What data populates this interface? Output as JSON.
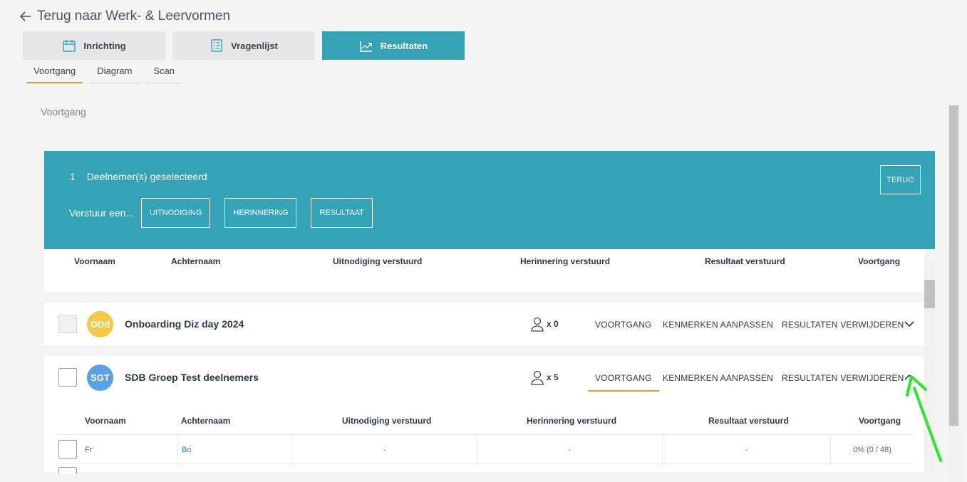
{
  "nav": {
    "back_label": "Terug naar Werk- & Leervormen"
  },
  "main_tabs": [
    {
      "label": "Inrichting",
      "icon": "calendar-icon"
    },
    {
      "label": "Vragenlijst",
      "icon": "checklist-icon"
    },
    {
      "label": "Resultaten",
      "icon": "trend-chart-icon",
      "active": true
    }
  ],
  "sub_tabs": [
    {
      "label": "Voortgang",
      "active": true
    },
    {
      "label": "Diagram"
    },
    {
      "label": "Scan"
    }
  ],
  "section_title": "Voortgang",
  "selection_bar": {
    "count": "1",
    "count_label": "Deelnemer(s) geselecteerd",
    "send_label": "Verstuur een...",
    "buttons": [
      "UITNODIGING",
      "HERINNERING",
      "RESULTAAT"
    ],
    "back_button": "TERUG"
  },
  "columns": {
    "first_name": "Voornaam",
    "last_name": "Achternaam",
    "invite_sent": "Uitnodiging verstuurd",
    "reminder_sent": "Herinnering verstuurd",
    "result_sent": "Resultaat verstuurd",
    "progress": "Voortgang"
  },
  "groups": [
    {
      "initials": "ODd",
      "name": "Onboarding Diz day 2024",
      "members": "x 0",
      "expanded": false
    },
    {
      "initials": "SGT",
      "name": "SDB Groep Test deelnemers",
      "members": "x 5",
      "expanded": true
    }
  ],
  "group_actions": {
    "progress": "VOORTGANG",
    "edit": "KENMERKEN AANPASSEN",
    "delete": "RESULTATEN VERWIJDEREN"
  },
  "participants": [
    {
      "first_name": "Fr",
      "last_name": "Bo",
      "invite_sent": "-",
      "reminder_sent": "-",
      "result_sent": "-",
      "progress": "0% (0 / 48)"
    }
  ],
  "colors": {
    "accent": "#33a3b5",
    "highlight": "#e09a3a",
    "annotation": "#2ee62e"
  }
}
